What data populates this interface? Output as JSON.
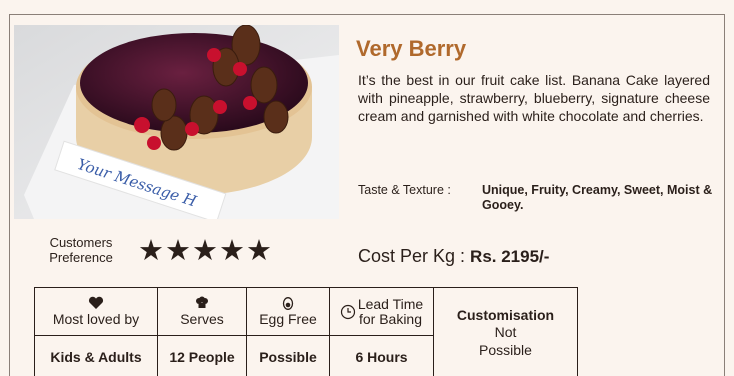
{
  "product": {
    "title": "Very Berry",
    "description": "It’s the best in our fruit cake list. Banana Cake layered with pineapple, strawberry, blueberry, signature cheese cream and garnished with white chocolate and cherries.",
    "taste_label": "Taste & Texture :",
    "taste_value": "Unique, Fruity, Creamy, Sweet, Moist & Gooey.",
    "photo_message": "Your Message H"
  },
  "preference": {
    "label_line1": "Customers",
    "label_line2": "Preference",
    "rating": 5,
    "stars": "★★★★★"
  },
  "cost": {
    "label": "Cost Per Kg : ",
    "value": "Rs. 2195/-"
  },
  "info_table": {
    "headers": {
      "loved": "Most loved by",
      "serves": "Serves",
      "egg": "Egg Free",
      "lead_line1": "Lead Time",
      "lead_line2": "for Baking",
      "custom": "Customisation"
    },
    "values": {
      "loved": "Kids & Adults",
      "serves": "12 People",
      "egg": "Possible",
      "lead": "6 Hours",
      "custom_line1": "Not",
      "custom_line2": "Possible"
    }
  },
  "icons": {
    "loved": "heart-icon",
    "serves": "chef-hat-icon",
    "egg": "egg-icon",
    "lead": "clock-icon"
  },
  "colors": {
    "title": "#b0692c",
    "background": "#fbf4ee",
    "text": "#2a1f1a"
  }
}
